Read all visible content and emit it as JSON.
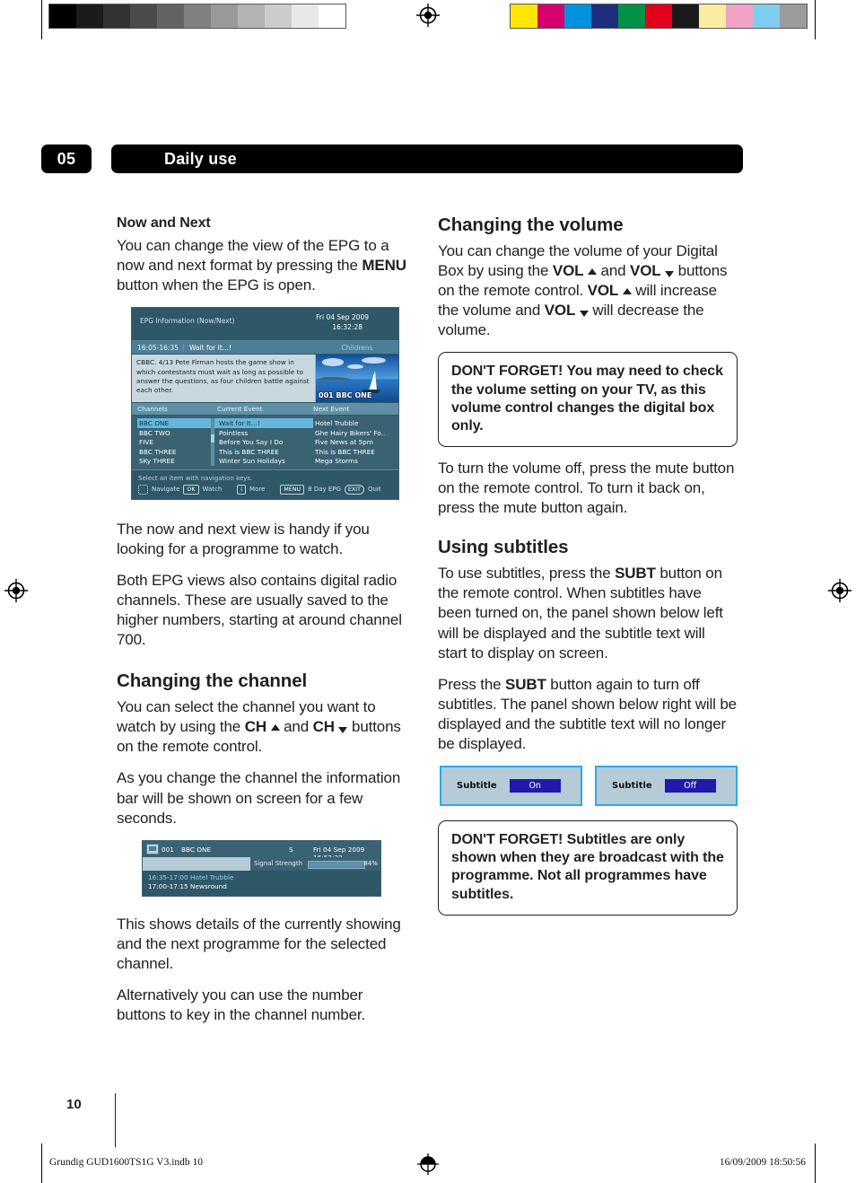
{
  "calibration": {
    "grayscale_swatches": [
      "#000000",
      "#1b1b1b",
      "#333333",
      "#4b4b4b",
      "#636363",
      "#808080",
      "#999999",
      "#b3b3b3",
      "#cccccc",
      "#e8e8e8",
      "#ffffff"
    ],
    "color_swatches": [
      "#ffe600",
      "#d6006e",
      "#0093dd",
      "#1c2f7c",
      "#009245",
      "#e2001a",
      "#1a1a1a",
      "#fbeda0",
      "#efa3c4",
      "#7fcdee",
      "#9b9b9b"
    ]
  },
  "header": {
    "chapter_number": "05",
    "chapter_title": "Daily use"
  },
  "left_column": {
    "heading_now_and_next": "Now and Next",
    "para_1_pre": "You can change the view of the EPG to a now and next format by pressing the ",
    "para_1_bold": "MENU",
    "para_1_post": " button when the EPG is open.",
    "para_2": "The now and next view is handy if you looking for a programme to watch.",
    "para_3": "Both EPG views also contains digital radio channels. These are usually saved to the higher numbers, starting at around channel 700.",
    "heading_changing_channel": "Changing the channel",
    "para_4_a": "You can select the channel you want to watch by using the ",
    "para_4_ch1": "CH",
    "para_4_b": " and ",
    "para_4_ch2": "CH",
    "para_4_c": " buttons on the remote control.",
    "para_5": "As you change the channel the information bar will be shown on screen for a few seconds.",
    "para_6": "This shows details of the currently showing and the next programme for the selected channel.",
    "para_7": "Alternatively you can use the number buttons to key in the channel number."
  },
  "epg_screenshot": {
    "title": "EPG Information (Now/Next)",
    "date": "Fri  04 Sep 2009",
    "time": "16:32:28",
    "now_time": "16:05-16:35",
    "now_title": "Wait for It...!",
    "now_genre": "Childrens",
    "description": "CBBC. 4/13 Pete Firman hosts the game show in which contestants must wait as long as possible to answer the questions, as four children battle against each other.",
    "thumb_channel": "001 BBC ONE",
    "col_headers": [
      "Channels",
      "Current Event",
      "Next Event"
    ],
    "rows": [
      {
        "channel": "BBC ONE",
        "current": "Wait for It...!",
        "next": "Hotel Trubble"
      },
      {
        "channel": "BBC TWO",
        "current": "Pointless",
        "next": "Ghe Hairy Bikers' Fo.."
      },
      {
        "channel": "FIVE",
        "current": "Before You Say I Do",
        "next": "Five News at 5pm"
      },
      {
        "channel": "BBC THREE",
        "current": "This is BBC THREE",
        "next": "This is BBC THREE"
      },
      {
        "channel": "SKy THREE",
        "current": "Winter Sun Holidays",
        "next": "Mega Storms"
      }
    ],
    "footer_hint": "Select an item with navigation keys.",
    "footer_keys": [
      {
        "cap": "",
        "label": "Navigate"
      },
      {
        "cap": "OK",
        "label": "Watch"
      },
      {
        "cap": "i",
        "label": "More"
      },
      {
        "cap": "MENU",
        "label": "8 Day EPG"
      },
      {
        "cap": "EXIT",
        "label": "Quit"
      }
    ]
  },
  "infobar_screenshot": {
    "channel_number": "001",
    "channel_name": "BBC ONE",
    "s_flag": "S",
    "datetime": "Fri 04 Sep 2009 16:52:22",
    "signal_label": "Signal Strength",
    "signal_percent": "84%",
    "signal_value": 84,
    "now_time": "16:35-17:00",
    "now_title": "Hotel Trubble",
    "next_time": "17:00-17:15",
    "next_title": "Newsround"
  },
  "right_column": {
    "heading_volume": "Changing the volume",
    "para_vol_a": "You can change the volume of your Digital Box by using the ",
    "vol1": "VOL",
    "para_vol_b": " and ",
    "vol2": "VOL",
    "para_vol_c": " buttons on the remote control. ",
    "vol3": "VOL",
    "para_vol_d": " will increase the volume and ",
    "vol4": "VOL",
    "para_vol_e": " will decrease the volume.",
    "callout_1": "DON'T FORGET! You may need to check the volume setting on your TV, as this volume control changes the digital box only.",
    "para_mute": "To turn the volume off, press the mute button on the remote control. To turn it back on, press the mute button again.",
    "heading_subtitles": "Using subtitles",
    "para_sub_1_a": "To use subtitles, press the ",
    "subt1": "SUBT",
    "para_sub_1_b": " button on the remote control. When subtitles have been turned on, the panel shown below left will be displayed and the subtitle text will start to display on screen.",
    "para_sub_2_a": "Press the  ",
    "subt2": "SUBT",
    "para_sub_2_b": " button again to turn off subtitles. The panel shown below right will be displayed and the subtitle text will no longer be displayed.",
    "callout_2": "DON'T FORGET! Subtitles are only shown when they are broadcast with the programme. Not all programmes have subtitles."
  },
  "subtitle_panels": [
    {
      "label": "Subtitle",
      "value": "On"
    },
    {
      "label": "Subtitle",
      "value": "Off"
    }
  ],
  "footer": {
    "page_number": "10",
    "file_name": "Grundig GUD1600TS1G V3.indb   10",
    "timestamp": "16/09/2009   18:50:56"
  }
}
